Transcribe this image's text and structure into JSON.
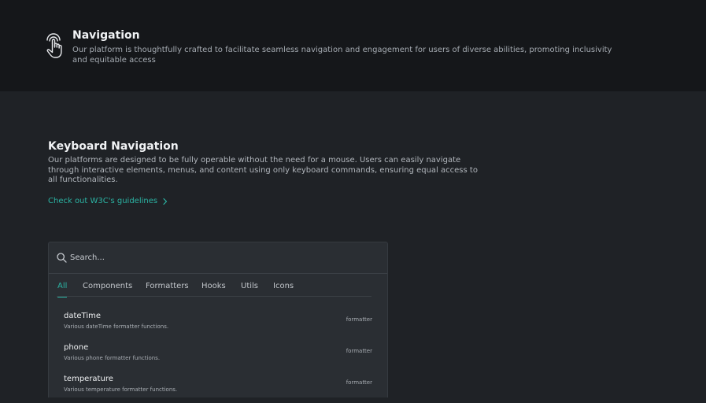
{
  "header": {
    "icon": "touch-hand-icon",
    "title": "Navigation",
    "description": "Our platform is thoughtfully crafted to facilitate seamless navigation and engagement for users of diverse abilities, promoting inclusivity and equitable access"
  },
  "keyboard": {
    "title": "Keyboard Navigation",
    "description": "Our platforms are designed to be fully operable without the need for a mouse. Users can easily navigate through interactive elements, menus, and content using only keyboard commands, ensuring equal access to all functionalities.",
    "link_label": "Check out W3C's guidelines",
    "link_icon": "chevron-right-icon"
  },
  "search": {
    "icon": "search-icon",
    "placeholder": "Search..."
  },
  "tabs": [
    {
      "label": "All",
      "active": true
    },
    {
      "label": "Components",
      "active": false
    },
    {
      "label": "Formatters",
      "active": false
    },
    {
      "label": "Hooks",
      "active": false
    },
    {
      "label": "Utils",
      "active": false
    },
    {
      "label": "Icons",
      "active": false
    }
  ],
  "results": [
    {
      "name": "dateTime",
      "description": "Various dateTime formatter functions.",
      "type": "formatter"
    },
    {
      "name": "phone",
      "description": "Various phone formatter functions.",
      "type": "formatter"
    },
    {
      "name": "temperature",
      "description": "Various temperature formatter functions.",
      "type": "formatter"
    }
  ],
  "colors": {
    "accent": "#2bb3a3",
    "header_bg": "#15171a",
    "page_bg": "#1f2226",
    "panel_bg": "#2a2e33"
  }
}
